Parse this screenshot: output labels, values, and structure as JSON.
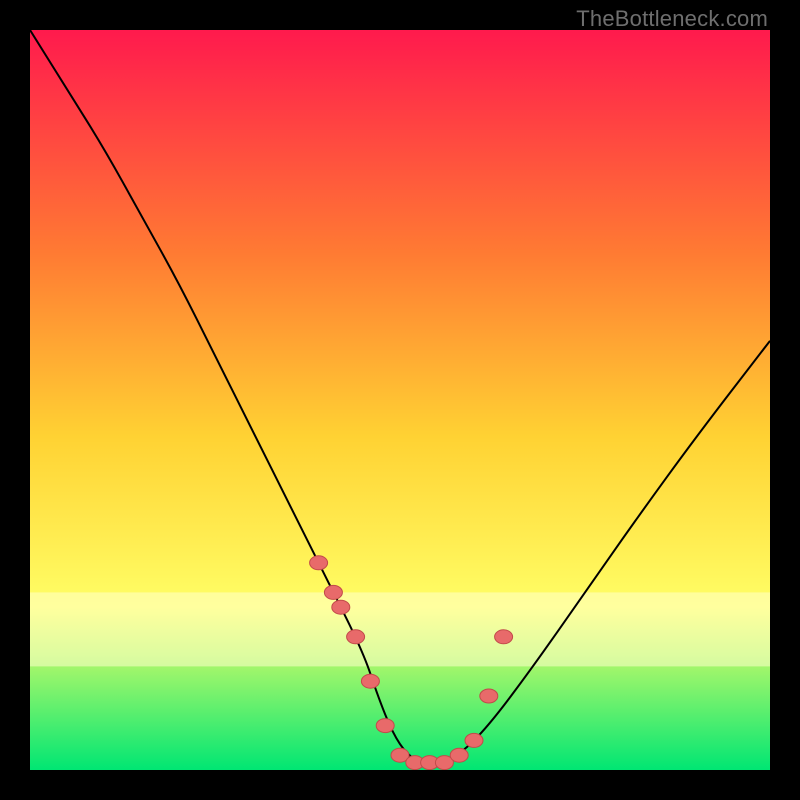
{
  "watermark": "TheBottleneck.com",
  "colors": {
    "bg_black": "#000000",
    "gradient_top": "#ff1a4d",
    "gradient_mid1": "#ff7a33",
    "gradient_mid2": "#ffd233",
    "gradient_mid3": "#ffff66",
    "gradient_bottom": "#00e673",
    "pale_band": "#ffffcc",
    "curve": "#000000",
    "marker_fill": "#e86a6a",
    "marker_stroke": "#c24a4a"
  },
  "chart_data": {
    "type": "line",
    "title": "",
    "xlabel": "",
    "ylabel": "",
    "xlim": [
      0,
      100
    ],
    "ylim": [
      0,
      100
    ],
    "grid": false,
    "legend": false,
    "series": [
      {
        "name": "bottleneck-curve",
        "x": [
          0,
          5,
          10,
          15,
          20,
          25,
          30,
          35,
          40,
          45,
          47,
          49,
          51,
          53,
          55,
          58,
          62,
          68,
          75,
          82,
          90,
          100
        ],
        "y": [
          100,
          92,
          84,
          75,
          66,
          56,
          46,
          36,
          26,
          16,
          10,
          5,
          2,
          1,
          1,
          2,
          6,
          14,
          24,
          34,
          45,
          58
        ]
      }
    ],
    "markers": {
      "name": "highlighted-points",
      "x": [
        39,
        41,
        42,
        44,
        46,
        48,
        50,
        52,
        54,
        56,
        58,
        60,
        62,
        64
      ],
      "y": [
        28,
        24,
        22,
        18,
        12,
        6,
        2,
        1,
        1,
        1,
        2,
        4,
        10,
        18
      ]
    },
    "notes": "V-shaped bottleneck curve over a vertical red→orange→yellow→green gradient background with a pale-yellow band near the bottom. Markers cluster around the minimum of the curve."
  }
}
